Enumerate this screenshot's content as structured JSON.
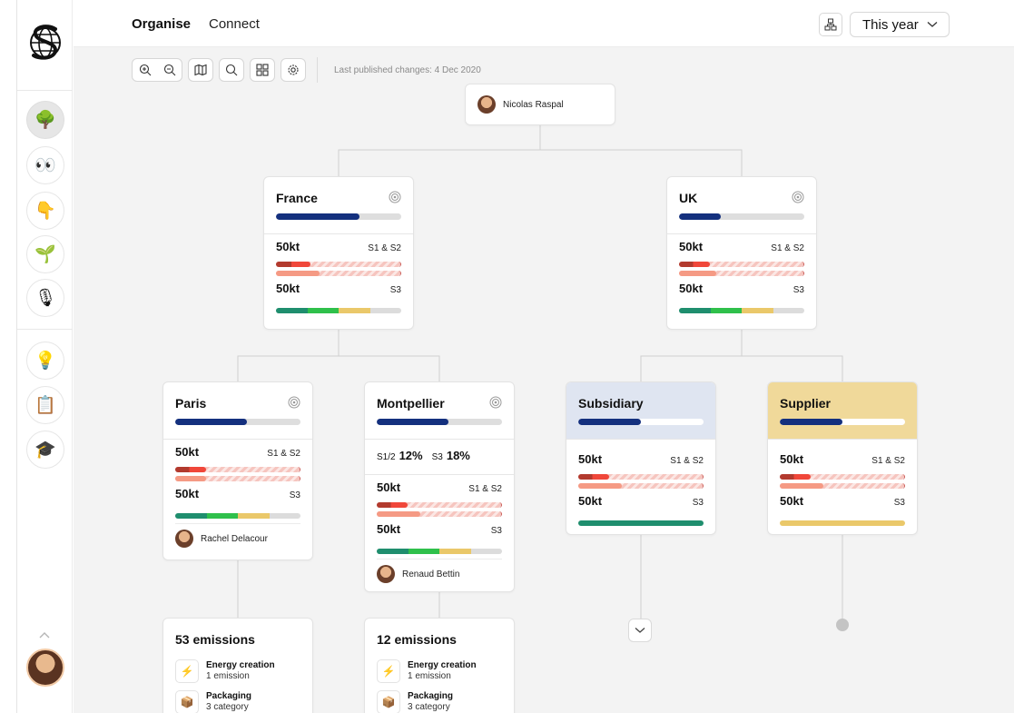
{
  "colors": {
    "navy": "#14307e",
    "track": "#dedede",
    "s12_red_dark": "#b23a2e",
    "s12_red": "#f0473a",
    "s12_salmon": "#f59a84",
    "s3_teal": "#1f8e6e",
    "s3_green": "#2fc04b",
    "s3_yellow": "#eac86a",
    "subsidiary_bg": "#dfe5f1",
    "supplier_bg": "#f0d99a"
  },
  "sidebar": {
    "logo": "globe-s-logo",
    "items": [
      {
        "name": "tree",
        "glyph": "🌳"
      },
      {
        "name": "eyes",
        "glyph": "👀"
      },
      {
        "name": "pointing-down",
        "glyph": "👇"
      },
      {
        "name": "seedling",
        "glyph": "🌱"
      },
      {
        "name": "microphone",
        "glyph": "🎙"
      },
      {
        "name": "light-bulb",
        "glyph": "💡"
      },
      {
        "name": "clipboard",
        "glyph": "📋"
      },
      {
        "name": "graduation-cap",
        "glyph": "🎓"
      }
    ]
  },
  "topbar": {
    "tabs": [
      "Organise",
      "Connect"
    ],
    "period": "This year"
  },
  "toolbar": {
    "published": "Last published changes: 4 Dec 2020"
  },
  "root": {
    "person": "Nicolas Raspal"
  },
  "nodes": {
    "france": {
      "title": "France",
      "progress": 0.67,
      "s12_value": "50kt",
      "s12_label": "S1 & S2",
      "s3_value": "50kt",
      "s3_label": "S3"
    },
    "uk": {
      "title": "UK",
      "progress": 0.33,
      "s12_value": "50kt",
      "s12_label": "S1 & S2",
      "s3_value": "50kt",
      "s3_label": "S3"
    },
    "paris": {
      "title": "Paris",
      "progress": 0.57,
      "s12_value": "50kt",
      "s12_label": "S1 & S2",
      "s3_value": "50kt",
      "s3_label": "S3",
      "person": "Rachel Delacour"
    },
    "montpellier": {
      "title": "Montpellier",
      "progress": 0.57,
      "ratio_s12_label": "S1/2",
      "ratio_s12": "12%",
      "ratio_s3_label": "S3",
      "ratio_s3": "18%",
      "s12_value": "50kt",
      "s12_label": "S1 & S2",
      "s3_value": "50kt",
      "s3_label": "S3",
      "person": "Renaud Bettin"
    },
    "subsidiary": {
      "title": "Subsidiary",
      "progress": 0.5,
      "s12_value": "50kt",
      "s12_label": "S1 & S2",
      "s3_value": "50kt",
      "s3_label": "S3"
    },
    "supplier": {
      "title": "Supplier",
      "progress": 0.5,
      "s12_value": "50kt",
      "s12_label": "S1 & S2",
      "s3_value": "50kt",
      "s3_label": "S3"
    }
  },
  "emissions": {
    "paris": {
      "title": "53 emissions",
      "items": [
        {
          "name": "Energy creation",
          "sub": "1 emission",
          "icon": "⚡"
        },
        {
          "name": "Packaging",
          "sub": "3 category",
          "icon": "📦"
        }
      ]
    },
    "montpellier": {
      "title": "12 emissions",
      "items": [
        {
          "name": "Energy creation",
          "sub": "1 emission",
          "icon": "⚡"
        },
        {
          "name": "Packaging",
          "sub": "3 category",
          "icon": "📦"
        }
      ]
    }
  }
}
